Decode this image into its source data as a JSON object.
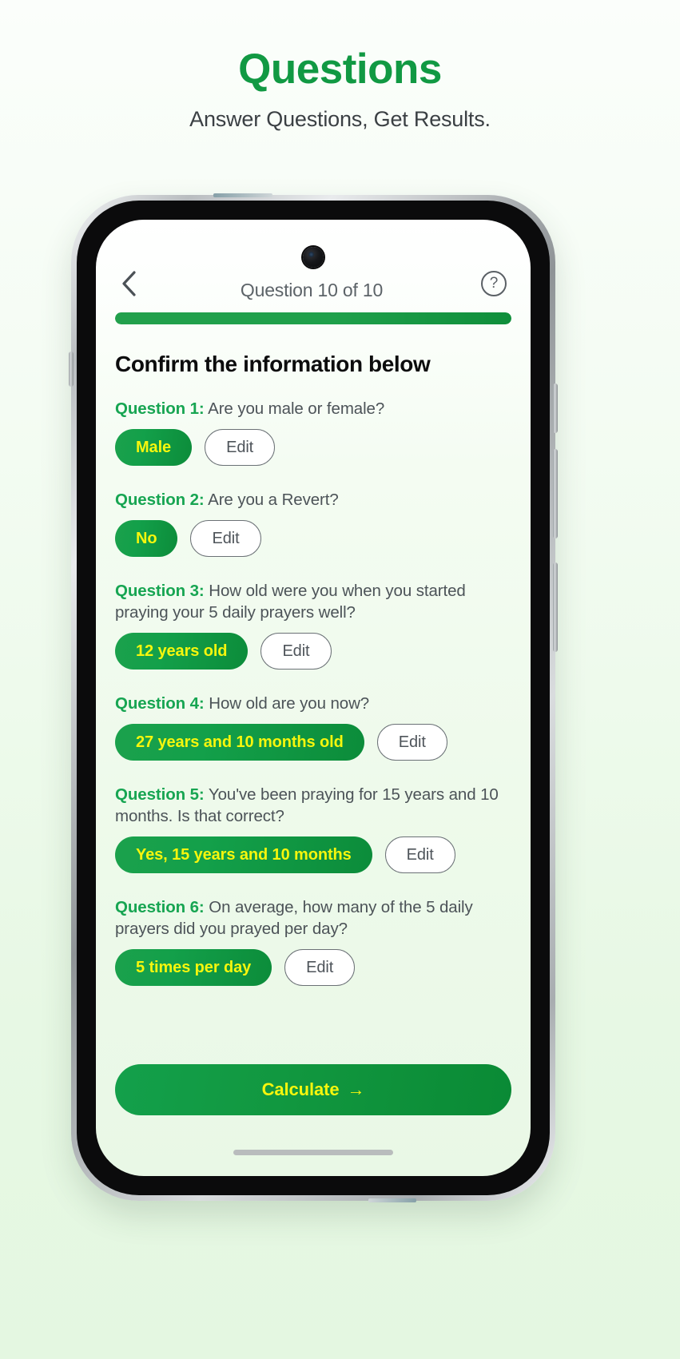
{
  "page": {
    "title": "Questions",
    "subtitle": "Answer Questions, Get Results."
  },
  "colors": {
    "brand_green": "#119943",
    "chip_green": "#13a04a",
    "chip_text_yellow": "#f6f60d",
    "question_label_green": "#17a552",
    "body_text": "#4c5358",
    "page_bg": "#e7f8e4"
  },
  "app": {
    "topbar": {
      "back_icon": "chevron-left-icon",
      "title": "Question 10 of 10",
      "help_icon": "question-mark-circle-icon",
      "help_glyph": "?"
    },
    "progress": {
      "percent": 100,
      "value_text": "100"
    },
    "section_heading": "Confirm the information below",
    "edit_label": "Edit",
    "questions": [
      {
        "label": "Question 1:",
        "text": "Are you male or female?",
        "answer": "Male",
        "edit": "Edit"
      },
      {
        "label": "Question 2:",
        "text": "Are you a Revert?",
        "answer": "No",
        "edit": "Edit"
      },
      {
        "label": "Question 3:",
        "text": "How old were you when you started praying your 5 daily prayers well?",
        "answer": "12 years old",
        "edit": "Edit"
      },
      {
        "label": "Question 4:",
        "text": "How old are you now?",
        "answer": "27 years and 10 months old",
        "edit": "Edit"
      },
      {
        "label": "Question 5:",
        "text": "You've been praying for 15 years and 10 months. Is that correct?",
        "answer": "Yes, 15 years and 10 months",
        "edit": "Edit"
      },
      {
        "label": "Question 6:",
        "text": "On average, how many of the 5 daily prayers did you prayed per day?",
        "answer": "5 times per day",
        "edit": "Edit"
      }
    ],
    "primary_button": {
      "label": "Calculate",
      "arrow": "→",
      "icon": "arrow-right-icon"
    }
  }
}
